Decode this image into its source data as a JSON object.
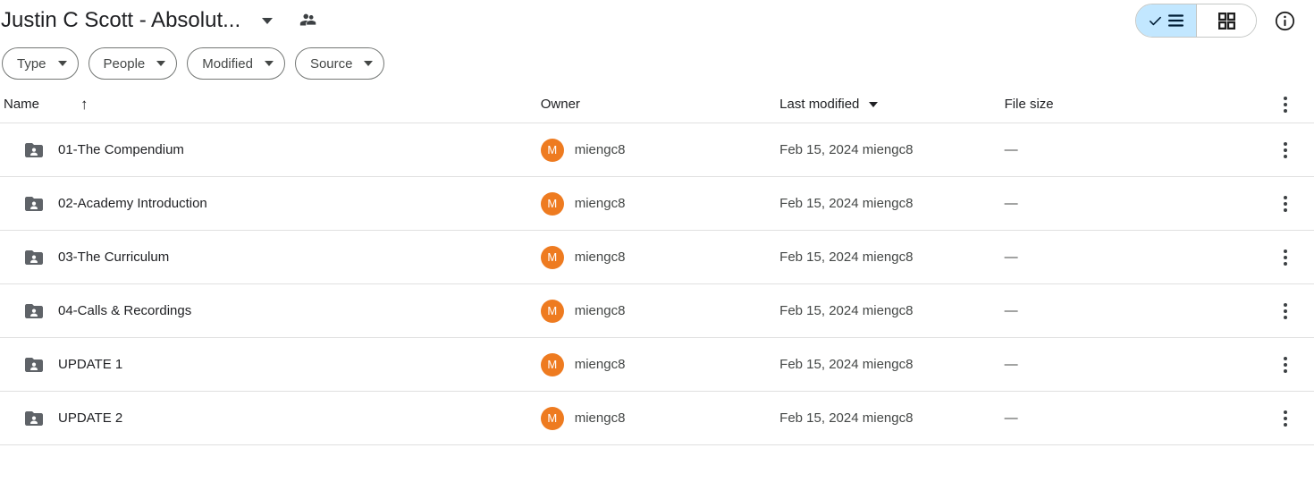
{
  "header": {
    "folder_title": "Justin C Scott - Absolut...",
    "title_caret_icon": "chevron-down-icon",
    "shared_people_icon": "people-icon",
    "view_toggle": {
      "list_label": "list-view",
      "list_icon": "check-list-icon",
      "list_selected": true,
      "grid_label": "grid-view",
      "grid_icon": "grid-icon",
      "grid_selected": false,
      "selected_bg": "#C2E7FF"
    },
    "info_icon": "info-circle-icon"
  },
  "filters": [
    {
      "label": "Type",
      "icon": "chevron-down-icon"
    },
    {
      "label": "People",
      "icon": "chevron-down-icon"
    },
    {
      "label": "Modified",
      "icon": "chevron-down-icon"
    },
    {
      "label": "Source",
      "icon": "chevron-down-icon"
    }
  ],
  "table": {
    "columns": {
      "name": "Name",
      "name_sort_icon": "arrow-up-icon",
      "owner": "Owner",
      "last_modified": "Last modified",
      "last_modified_icon": "chevron-down-icon",
      "file_size": "File size"
    },
    "header_menu_icon": "more-vertical-icon",
    "rows": [
      {
        "icon": "shared-folder-icon",
        "name": "01-The Compendium",
        "owner_initial": "M",
        "owner": "miengc8",
        "last_modified": "Feb 15, 2024 miengc8",
        "file_size": "—",
        "menu_icon": "more-vertical-icon"
      },
      {
        "icon": "shared-folder-icon",
        "name": "02-Academy Introduction",
        "owner_initial": "M",
        "owner": "miengc8",
        "last_modified": "Feb 15, 2024 miengc8",
        "file_size": "—",
        "menu_icon": "more-vertical-icon"
      },
      {
        "icon": "shared-folder-icon",
        "name": "03-The Curriculum",
        "owner_initial": "M",
        "owner": "miengc8",
        "last_modified": "Feb 15, 2024 miengc8",
        "file_size": "—",
        "menu_icon": "more-vertical-icon"
      },
      {
        "icon": "shared-folder-icon",
        "name": "04-Calls & Recordings",
        "owner_initial": "M",
        "owner": "miengc8",
        "last_modified": "Feb 15, 2024 miengc8",
        "file_size": "—",
        "menu_icon": "more-vertical-icon"
      },
      {
        "icon": "shared-folder-icon",
        "name": "UPDATE 1",
        "owner_initial": "M",
        "owner": "miengc8",
        "last_modified": "Feb 15, 2024 miengc8",
        "file_size": "—",
        "menu_icon": "more-vertical-icon"
      },
      {
        "icon": "shared-folder-icon",
        "name": "UPDATE 2",
        "owner_initial": "M",
        "owner": "miengc8",
        "last_modified": "Feb 15, 2024 miengc8",
        "file_size": "—",
        "menu_icon": "more-vertical-icon"
      }
    ]
  },
  "colors": {
    "avatar_bg": "#EE7B20",
    "toggle_active_bg": "#C2E7FF",
    "folder_icon": "#5F6368",
    "divider": "#E0E0E0"
  }
}
